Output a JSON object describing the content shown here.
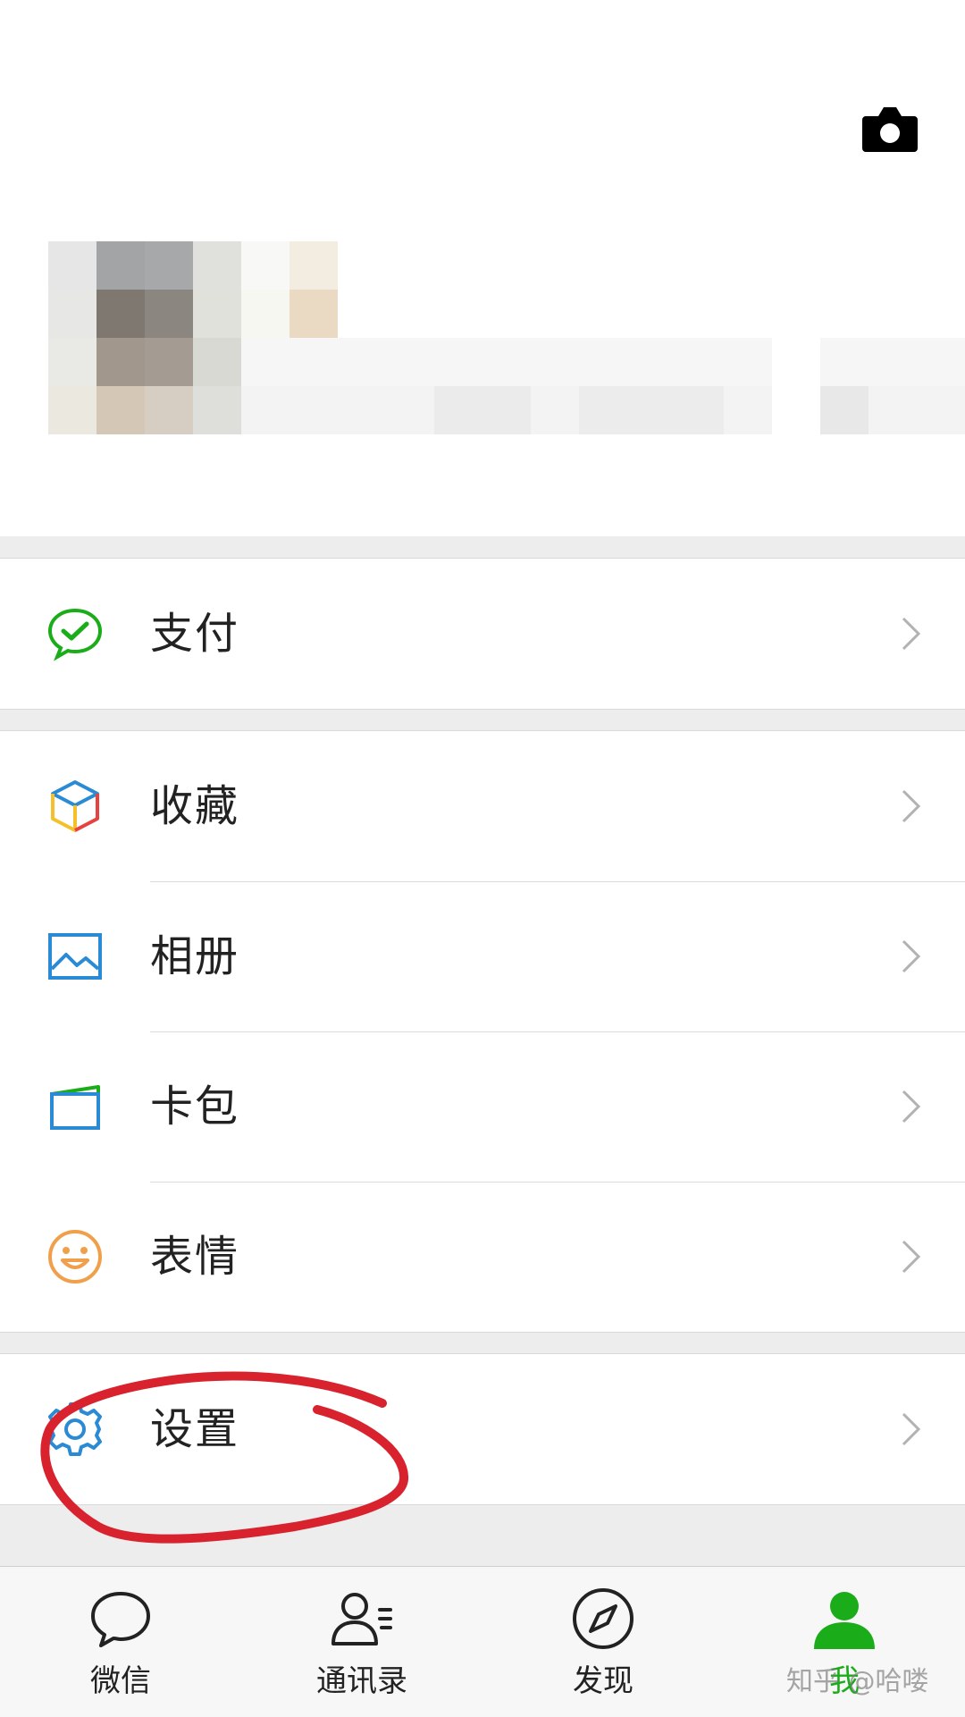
{
  "menu": {
    "pay": {
      "label": "支付",
      "icon": "wechat-pay-icon"
    },
    "favorites": {
      "label": "收藏",
      "icon": "favorites-cube-icon"
    },
    "album": {
      "label": "相册",
      "icon": "album-image-icon"
    },
    "cards": {
      "label": "卡包",
      "icon": "card-wallet-icon"
    },
    "stickers": {
      "label": "表情",
      "icon": "smiley-icon"
    },
    "settings": {
      "label": "设置",
      "icon": "gear-icon"
    }
  },
  "tabs": [
    {
      "label": "微信",
      "icon": "chat-bubble-icon",
      "active": false
    },
    {
      "label": "通讯录",
      "icon": "contacts-icon",
      "active": false
    },
    {
      "label": "发现",
      "icon": "compass-icon",
      "active": false
    },
    {
      "label": "我",
      "icon": "person-icon",
      "active": true
    }
  ],
  "watermark": "知乎 @哈喽",
  "colors": {
    "brand_green": "#1aad19",
    "annotation_red": "#d8232f",
    "icon_blue": "#2a8ad4"
  }
}
